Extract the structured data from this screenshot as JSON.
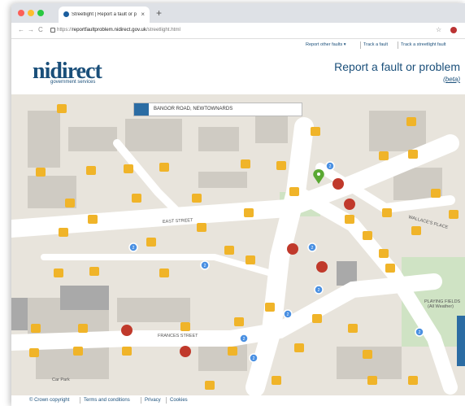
{
  "browser": {
    "tab_title": "Streetlight | Report a fault or p",
    "tab_close": "×",
    "new_tab": "+",
    "url_prefix": "https://",
    "url_host": "reportfaultproblem.nidirect.gov.uk",
    "url_path": "/streetlight.html",
    "back_glyph": "←",
    "forward_glyph": "→",
    "reload_glyph": "C",
    "star_glyph": "☆",
    "colors": {
      "close": "#fc5f57",
      "minimize": "#fdbc2e",
      "maximize": "#28c840"
    }
  },
  "topnav": {
    "items": [
      "Report other faults ▾",
      "Track a fault",
      "Track a streetlight fault"
    ]
  },
  "header": {
    "logo_text": "nidirect",
    "logo_sub": "government services",
    "title": "Report a fault or problem",
    "beta": "(beta)"
  },
  "map": {
    "search_value": "BANGOR ROAD, NEWTOWNARDS",
    "search_icon": "grid-icon",
    "street_labels": [
      "EAST STREET",
      "FRANCES STREET",
      "WALLACE'S PLACE",
      "PLAYING FIELDS (All Weather)",
      "Car Park"
    ],
    "cluster_count": "2",
    "colors": {
      "road": "#ffffff",
      "block": "#c9c9c9",
      "background": "#e8e4dc",
      "marker": "#f0b429",
      "fault": "#c0392b",
      "cluster": "#4a90e2",
      "pin": "#5aa832"
    }
  },
  "footer": {
    "items": [
      "© Crown copyright",
      "Terms and conditions",
      "Privacy",
      "Cookies"
    ]
  }
}
